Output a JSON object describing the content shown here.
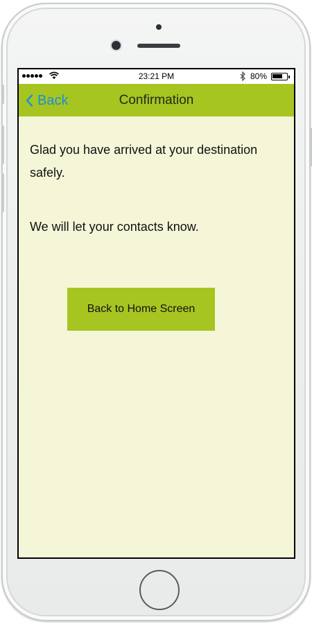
{
  "status_bar": {
    "time": "23:21 PM",
    "battery_percent": "80%",
    "battery_level": 0.8,
    "signal_dots": 5,
    "icons": [
      "signal-dots-icon",
      "wifi-icon",
      "bluetooth-icon",
      "battery-icon"
    ]
  },
  "nav": {
    "back_label": "Back",
    "title": "Confirmation",
    "back_icon": "chevron-left-icon"
  },
  "content": {
    "message_1": "Glad you have arrived at your destination safely.",
    "message_2": "We will let your contacts know.",
    "button_label": "Back to Home Screen"
  },
  "colors": {
    "nav_bar": "#a6c521",
    "screen_background": "#f5f6d8",
    "back_link": "#1f8dd6",
    "button": "#a6c521"
  }
}
